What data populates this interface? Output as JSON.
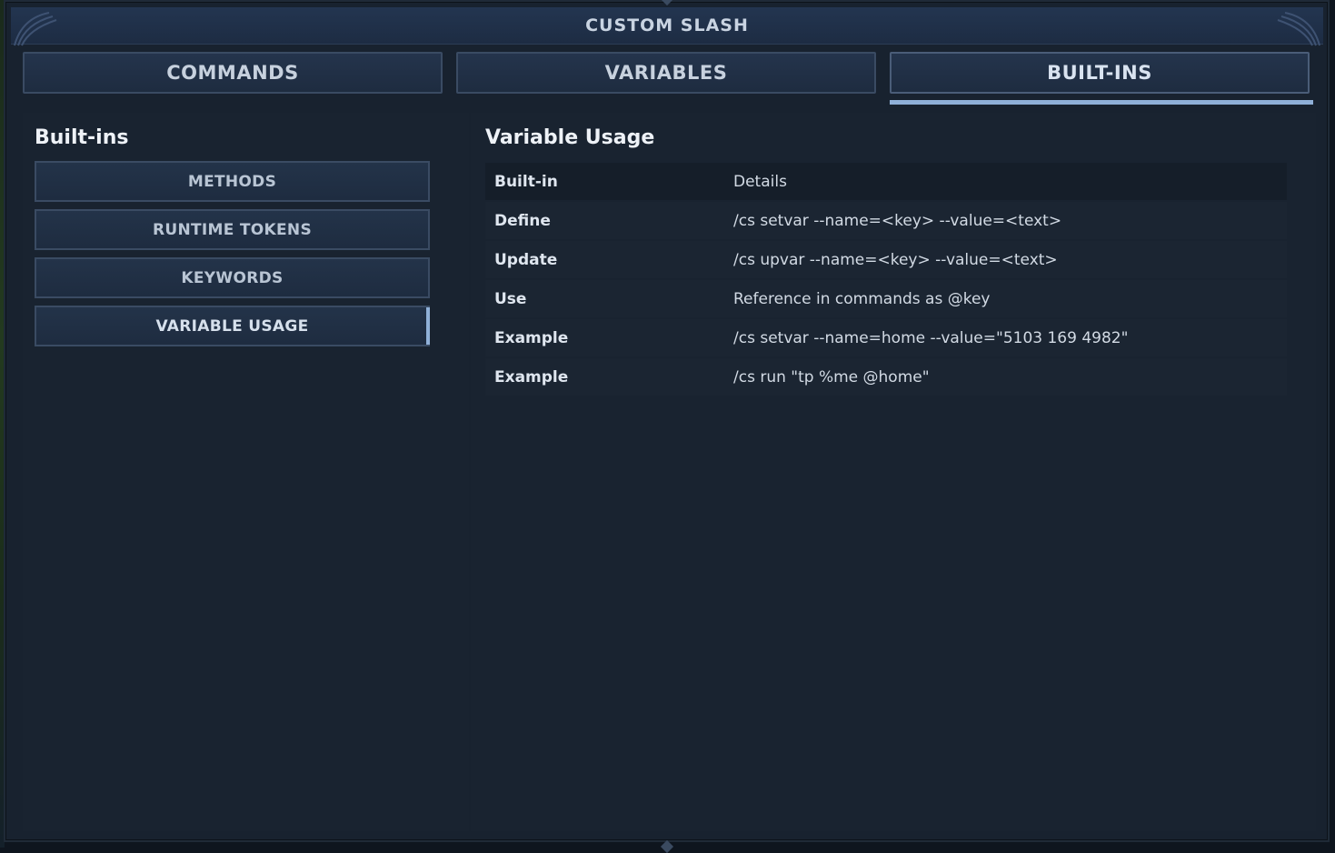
{
  "window": {
    "title": "CUSTOM SLASH"
  },
  "tabs": [
    {
      "label": "COMMANDS",
      "active": false
    },
    {
      "label": "VARIABLES",
      "active": false
    },
    {
      "label": "BUILT-INS",
      "active": true
    }
  ],
  "sidebar": {
    "title": "Built-ins",
    "items": [
      {
        "label": "METHODS",
        "active": false
      },
      {
        "label": "RUNTIME TOKENS",
        "active": false
      },
      {
        "label": "KEYWORDS",
        "active": false
      },
      {
        "label": "VARIABLE USAGE",
        "active": true
      }
    ]
  },
  "content": {
    "title": "Variable Usage",
    "table": {
      "header": {
        "key": "Built-in",
        "value": "Details"
      },
      "rows": [
        {
          "key": "Define",
          "value": "/cs setvar --name=<key> --value=<text>"
        },
        {
          "key": "Update",
          "value": "/cs upvar --name=<key> --value=<text>"
        },
        {
          "key": "Use",
          "value": "Reference in commands as @key"
        },
        {
          "key": "Example",
          "value": "/cs setvar --name=home --value=\"5103 169 4982\""
        },
        {
          "key": "Example",
          "value": "/cs run \"tp %me @home\""
        }
      ]
    }
  },
  "colors": {
    "background": "#18222f",
    "titlebar": "#233550",
    "accent": "#8fb0d8",
    "button_border": "#3a4b63"
  }
}
